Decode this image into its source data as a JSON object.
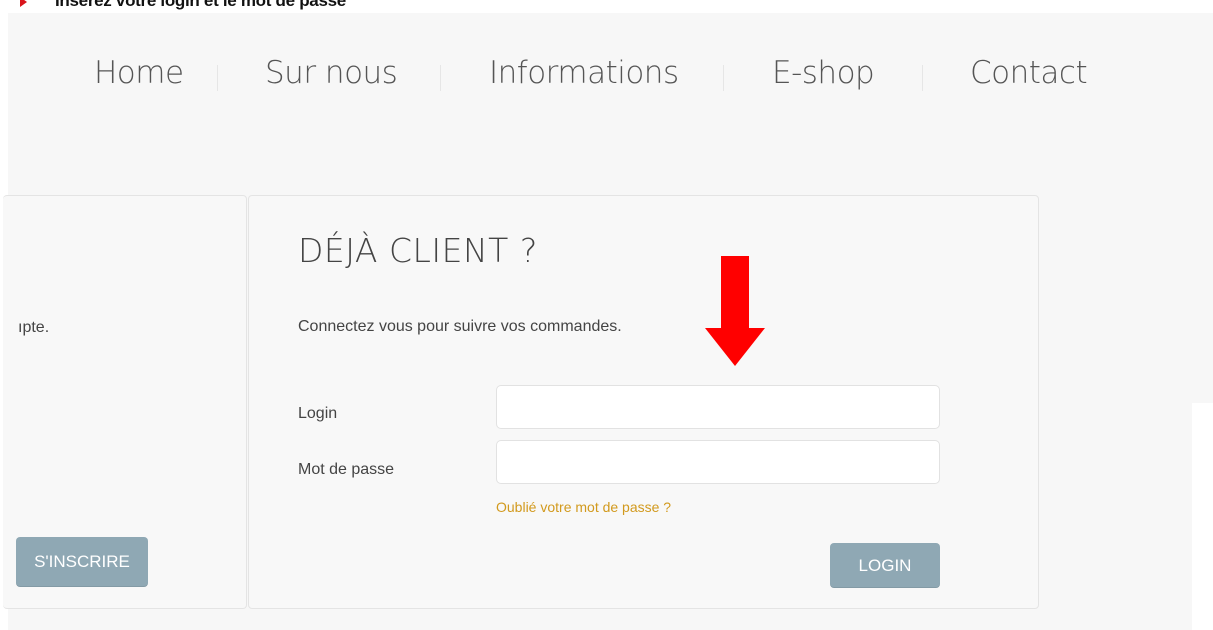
{
  "instruction": {
    "text": "Insérez votre login et le mot de passe",
    "bullet_color": "#d9141b"
  },
  "nav": {
    "items": [
      {
        "label": "Home"
      },
      {
        "label": "Sur nous"
      },
      {
        "label": "Informations"
      },
      {
        "label": "E-shop"
      },
      {
        "label": "Contact"
      }
    ]
  },
  "signup_panel": {
    "partial_text": "ıpte.",
    "button_label": "S'INSCRIRE"
  },
  "login_panel": {
    "heading": "DÉJÀ CLIENT ?",
    "subtitle": "Connectez vous pour suivre vos commandes.",
    "login_label": "Login",
    "login_value": "",
    "password_label": "Mot de passe",
    "password_value": "",
    "forgot_link": "Oublié votre mot de passe ?",
    "button_label": "LOGIN"
  },
  "annotation": {
    "arrow_color": "#ff0000",
    "icon": "arrow-down-icon"
  },
  "colors": {
    "button_bg": "#8fa8b4",
    "link": "#d29a1e",
    "page_bg": "#f7f7f7"
  }
}
